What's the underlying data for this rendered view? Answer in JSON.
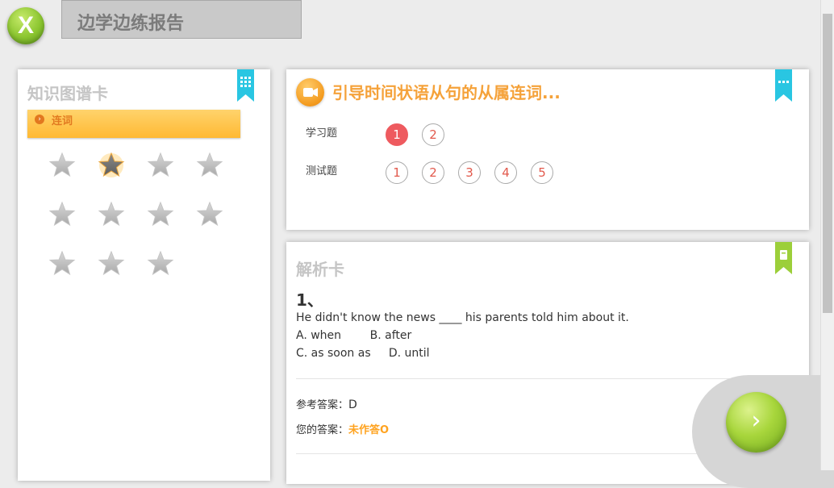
{
  "header": {
    "logo_text": "X",
    "report_title": "边学边练报告"
  },
  "knowledge_card": {
    "heading": "知识图谱卡",
    "ribbon_icon": "grid-icon",
    "ribbon_color": "#29c6e2",
    "tag": {
      "label": "连词",
      "icon": "chevron-right-icon"
    },
    "stars": [
      {
        "state": "gray"
      },
      {
        "state": "highlighted"
      },
      {
        "state": "gray"
      },
      {
        "state": "gray"
      },
      {
        "state": "gray"
      },
      {
        "state": "gray"
      },
      {
        "state": "gray"
      },
      {
        "state": "gray"
      },
      {
        "state": "gray"
      },
      {
        "state": "gray"
      },
      {
        "state": "gray"
      }
    ]
  },
  "question_card": {
    "title": "引导时间状语从句的从属连词...",
    "icon": "video-camera-icon",
    "ribbon_icon": "more-icon",
    "ribbon_color": "#29c6e2",
    "study": {
      "label": "学习题",
      "items": [
        "1",
        "2"
      ],
      "active_index": 0
    },
    "test": {
      "label": "测试题",
      "items": [
        "1",
        "2",
        "3",
        "4",
        "5"
      ]
    }
  },
  "analysis_card": {
    "heading": "解析卡",
    "ribbon_icon": "book-icon",
    "ribbon_color": "#9ccf3a",
    "question_number": "1、",
    "question_text": "He didn't know the news ____ his parents told him about it.",
    "options_line1": "A. when        B. after",
    "options_line2": "C. as soon as     D. until",
    "reference_label": "参考答案：",
    "reference_value": "D",
    "your_label": "您的答案：",
    "your_value": "未作答",
    "your_value_mark": "O"
  },
  "next_button": {
    "icon": "arrow-right-icon"
  },
  "colors": {
    "accent_orange": "#f5a23a",
    "active_red": "#ee5a5f",
    "number_red": "#e2594c",
    "unanswered_orange": "#ffa31f"
  }
}
